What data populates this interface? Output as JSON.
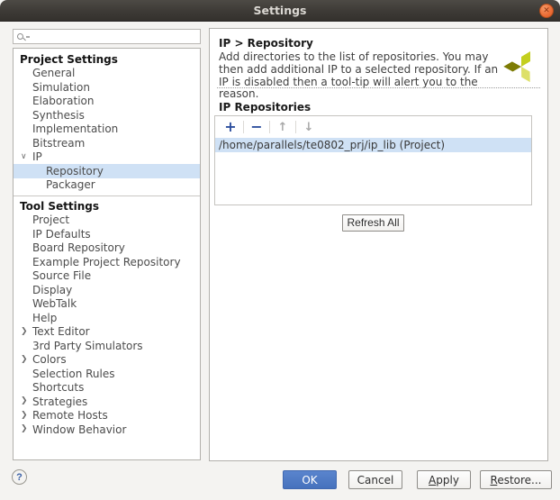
{
  "window": {
    "title": "Settings",
    "close_glyph": "✕"
  },
  "sidebar": {
    "search": {
      "placeholder": ""
    },
    "tree": [
      {
        "label": "Project Settings"
      },
      {
        "label": "General"
      },
      {
        "label": "Simulation"
      },
      {
        "label": "Elaboration"
      },
      {
        "label": "Synthesis"
      },
      {
        "label": "Implementation"
      },
      {
        "label": "Bitstream"
      },
      {
        "label": "IP",
        "arrow": "∨"
      },
      {
        "label": "Repository",
        "selected": true
      },
      {
        "label": "Packager"
      },
      {
        "label": "Tool Settings"
      },
      {
        "label": "Project"
      },
      {
        "label": "IP Defaults"
      },
      {
        "label": "Board Repository"
      },
      {
        "label": "Example Project Repository"
      },
      {
        "label": "Source File"
      },
      {
        "label": "Display"
      },
      {
        "label": "WebTalk"
      },
      {
        "label": "Help"
      },
      {
        "label": "Text Editor",
        "arrow": "❯"
      },
      {
        "label": "3rd Party Simulators"
      },
      {
        "label": "Colors",
        "arrow": "❯"
      },
      {
        "label": "Selection Rules"
      },
      {
        "label": "Shortcuts"
      },
      {
        "label": "Strategies",
        "arrow": "❯"
      },
      {
        "label": "Remote Hosts",
        "arrow": "❯"
      },
      {
        "label": "Window Behavior",
        "arrow": "❯"
      }
    ]
  },
  "main": {
    "title": "IP > Repository",
    "description": "Add directories to the list of repositories. You may then add additional IP to a selected repository. If an IP is disabled then a tool-tip will alert you to the reason.",
    "section_title": "IP Repositories",
    "toolbar": {
      "add": "+",
      "remove": "−",
      "up": "↑",
      "down": "↓"
    },
    "repositories": [
      {
        "path": "/home/parallels/te0802_prj/ip_lib (Project)",
        "selected": true
      }
    ],
    "refresh_button": "Refresh All"
  },
  "footer": {
    "help": "?",
    "ok": "OK",
    "cancel": "Cancel",
    "apply": {
      "mnemonic": "A",
      "rest": "pply"
    },
    "restore": {
      "mnemonic": "R",
      "rest": "estore..."
    }
  },
  "colors": {
    "selection_blue": "#cfe1f5",
    "toolbar_icon_blue": "#2d4f9e",
    "ok_button_blue": "#4d7ac4",
    "logo_dark_olive": "#7d7c04",
    "logo_yellow_green": "#c3cf1e",
    "logo_light_green": "#dde06a",
    "close_button_orange": "#ec6f38"
  }
}
